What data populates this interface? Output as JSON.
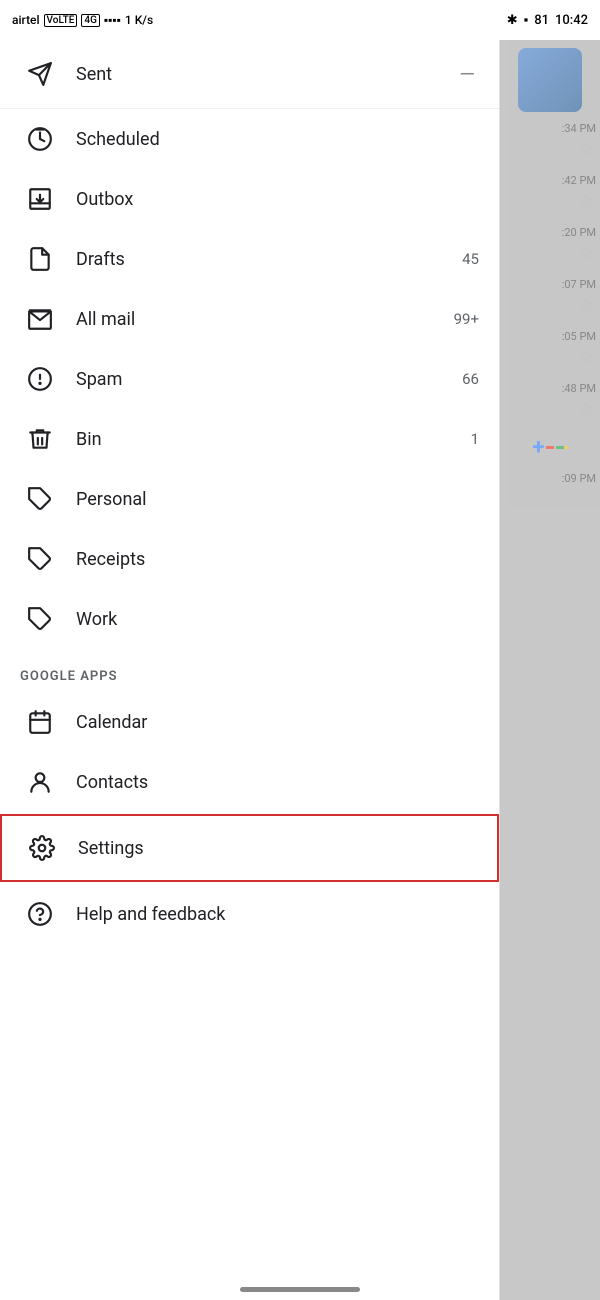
{
  "statusBar": {
    "carrier": "airtel",
    "networkType": "VoLTE 4G",
    "signal": "▪▪▪",
    "dataSpeed": "1 K/s",
    "bluetooth": "✱",
    "battery": "81",
    "time": "10:42"
  },
  "drawer": {
    "sentLabel": "Sent",
    "items": [
      {
        "id": "scheduled",
        "label": "Scheduled",
        "badge": "",
        "icon": "scheduled-icon"
      },
      {
        "id": "outbox",
        "label": "Outbox",
        "badge": "",
        "icon": "outbox-icon"
      },
      {
        "id": "drafts",
        "label": "Drafts",
        "badge": "45",
        "icon": "drafts-icon"
      },
      {
        "id": "allmail",
        "label": "All mail",
        "badge": "99+",
        "icon": "allmail-icon"
      },
      {
        "id": "spam",
        "label": "Spam",
        "badge": "66",
        "icon": "spam-icon"
      },
      {
        "id": "bin",
        "label": "Bin",
        "badge": "1",
        "icon": "bin-icon"
      },
      {
        "id": "personal",
        "label": "Personal",
        "badge": "",
        "icon": "label-icon"
      },
      {
        "id": "receipts",
        "label": "Receipts",
        "badge": "",
        "icon": "label-icon"
      },
      {
        "id": "work",
        "label": "Work",
        "badge": "",
        "icon": "label-icon"
      }
    ],
    "googleAppsHeader": "GOOGLE APPS",
    "googleApps": [
      {
        "id": "calendar",
        "label": "Calendar",
        "icon": "calendar-icon"
      },
      {
        "id": "contacts",
        "label": "Contacts",
        "icon": "contacts-icon"
      }
    ],
    "settingsLabel": "Settings",
    "helpLabel": "Help and feedback"
  },
  "emailTimes": [
    ":34 PM",
    ":42 PM",
    ":20 PM",
    ":07 PM",
    ":05 PM",
    ":48 PM",
    ":09 PM"
  ]
}
